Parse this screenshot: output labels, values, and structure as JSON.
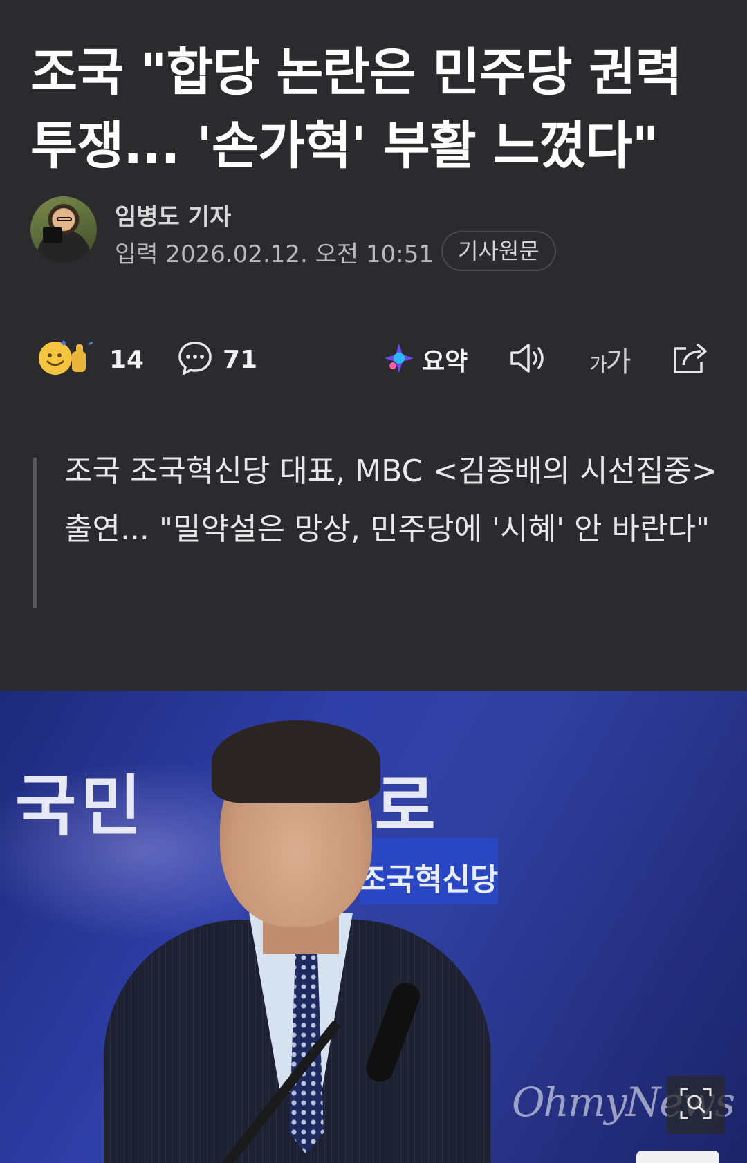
{
  "article": {
    "headline": "조국 \"합당 논란은 민주당 권력 투쟁... '손가혁' 부활 느꼈다\"",
    "reporter": "임병도 기자",
    "published": "입력 2026.02.12. 오전 10:51",
    "source_label": "기사원문"
  },
  "actions": {
    "reaction_count": "14",
    "comment_count": "71",
    "summary_label": "요약",
    "fontsize_small": "가",
    "fontsize_large": "가"
  },
  "summary": {
    "text": "조국 조국혁신당 대표, MBC <김종배의 시선집중> 출연... \"밀약설은 망상, 민주당에 '시혜' 안 바란다\""
  },
  "photo": {
    "banner_text": "국민",
    "banner_text_right": "으로",
    "party_label": "조국혁신당",
    "watermark": "OhmyNews"
  },
  "colors": {
    "background": "#2b2b2d",
    "accent_photo": "#2f3fa8"
  },
  "icons": [
    "reaction-emoji-icon",
    "comment-bubble-icon",
    "ai-summary-icon",
    "speaker-icon",
    "font-size-icon",
    "share-icon",
    "zoom-search-icon"
  ]
}
